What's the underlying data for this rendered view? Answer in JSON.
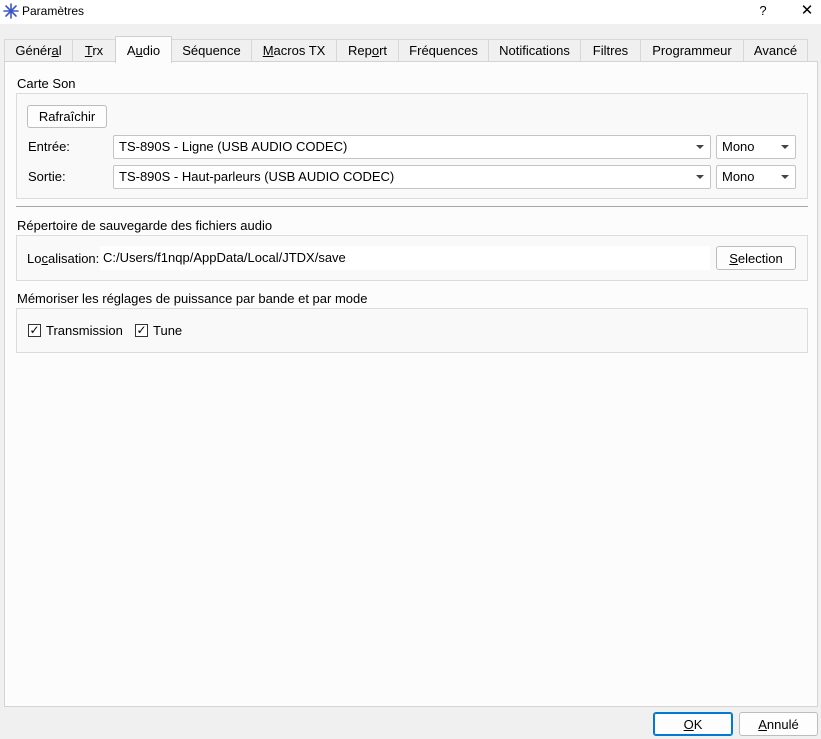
{
  "window": {
    "title": "Paramètres",
    "help_glyph": "?",
    "close_glyph": "✕"
  },
  "tabs": [
    {
      "pre": "Génér",
      "ul": "a",
      "post": "l"
    },
    {
      "pre": "",
      "ul": "T",
      "post": "rx"
    },
    {
      "pre": "A",
      "ul": "u",
      "post": "dio"
    },
    {
      "pre": "Séquence",
      "ul": "",
      "post": ""
    },
    {
      "pre": "",
      "ul": "M",
      "post": "acros TX"
    },
    {
      "pre": "Rep",
      "ul": "o",
      "post": "rt"
    },
    {
      "pre": "Fréquences",
      "ul": "",
      "post": ""
    },
    {
      "pre": "Notifications",
      "ul": "",
      "post": ""
    },
    {
      "pre": "Filtres",
      "ul": "",
      "post": ""
    },
    {
      "pre": "Programmeur",
      "ul": "",
      "post": ""
    },
    {
      "pre": "Avancé",
      "ul": "",
      "post": ""
    }
  ],
  "soundcard": {
    "title": "Carte Son",
    "refresh_label": "Rafraîchir",
    "input_label": "Entrée:",
    "input_device": "TS-890S - Ligne (USB AUDIO  CODEC)",
    "input_channel": "Mono",
    "output_label": "Sortie:",
    "output_device": "TS-890S - Haut-parleurs (USB AUDIO  CODEC)",
    "output_channel": "Mono"
  },
  "save_dir": {
    "title": "Répertoire de sauvegarde des fichiers audio",
    "location_pre": "Lo",
    "location_ul": "c",
    "location_post": "alisation:",
    "path": "C:/Users/f1nqp/AppData/Local/JTDX/save",
    "select_pre": "",
    "select_ul": "S",
    "select_post": "election"
  },
  "power": {
    "title": "Mémoriser les réglages de puissance par bande et par mode",
    "transmission_label": "Transmission",
    "tune_label": "Tune",
    "check_glyph": "✓"
  },
  "footer": {
    "ok_pre": "",
    "ok_ul": "O",
    "ok_post": "K",
    "cancel_pre": "",
    "cancel_ul": "A",
    "cancel_post": "nnulé"
  }
}
